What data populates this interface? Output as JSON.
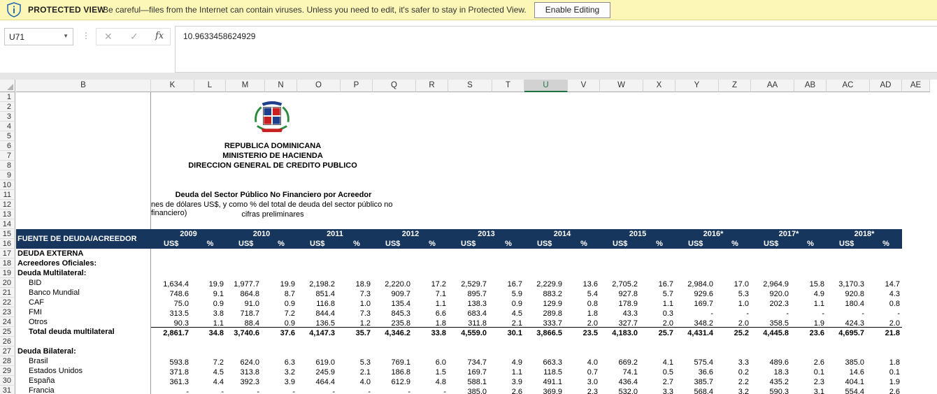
{
  "protected_view": {
    "label": "PROTECTED VIEW",
    "message": "Be careful—files from the Internet can contain viruses. Unless you need to edit, it's safer to stay in Protected View.",
    "button": "Enable Editing"
  },
  "formula_bar": {
    "name_box": "U71",
    "formula": "10.9633458624929",
    "fx_label": "fx"
  },
  "columns": [
    "B",
    "K",
    "L",
    "M",
    "N",
    "O",
    "P",
    "Q",
    "R",
    "S",
    "T",
    "U",
    "V",
    "W",
    "X",
    "Y",
    "Z",
    "AA",
    "AB",
    "AC",
    "AD",
    "AE"
  ],
  "selected_column": "U",
  "row_numbers": [
    "1",
    "2",
    "3",
    "4",
    "5",
    "6",
    "7",
    "8",
    "9",
    "10",
    "11",
    "12",
    "13",
    "14",
    "15",
    "16",
    "17",
    "18",
    "19",
    "20",
    "21",
    "22",
    "23",
    "24",
    "25",
    "26",
    "27",
    "28",
    "29",
    "30",
    "31"
  ],
  "header_lines": {
    "line1": "REPUBLICA DOMINICANA",
    "line2": "MINISTERIO DE HACIENDA",
    "line3": "DIRECCION GENERAL DE CREDITO PUBLICO"
  },
  "report_title": {
    "title": "Deuda del Sector Público No Financiero por Acreedor",
    "subtitle": "nes de dólares US$, y como % del total de deuda del sector público no financiero)",
    "note": "cifras preliminares"
  },
  "table_header": {
    "label": "FUENTE DE DEUDA/ACREEDOR",
    "years": [
      "2009",
      "2010",
      "2011",
      "2012",
      "2013",
      "2014",
      "2015",
      "2016*",
      "2017*",
      "2018*"
    ],
    "usd": "US$",
    "pct": "%"
  },
  "rows": [
    {
      "label": "DEUDA EXTERNA",
      "style": "bold",
      "values": []
    },
    {
      "label": "Acreedores Oficiales:",
      "style": "bold",
      "values": []
    },
    {
      "label": "Deuda Multilateral:",
      "style": "bold",
      "values": []
    },
    {
      "label": "BID",
      "style": "i1",
      "values": [
        "1,634.4",
        "19.9",
        "1,977.7",
        "19.9",
        "2,198.2",
        "18.9",
        "2,220.0",
        "17.2",
        "2,529.7",
        "16.7",
        "2,229.9",
        "13.6",
        "2,705.2",
        "16.7",
        "2,984.0",
        "17.0",
        "2,964.9",
        "15.8",
        "3,170.3",
        "14.7"
      ]
    },
    {
      "label": "Banco Mundial",
      "style": "i1",
      "values": [
        "748.6",
        "9.1",
        "864.8",
        "8.7",
        "851.4",
        "7.3",
        "909.7",
        "7.1",
        "895.7",
        "5.9",
        "883.2",
        "5.4",
        "927.8",
        "5.7",
        "929.6",
        "5.3",
        "920.0",
        "4.9",
        "920.8",
        "4.3"
      ]
    },
    {
      "label": "CAF",
      "style": "i1",
      "values": [
        "75.0",
        "0.9",
        "91.0",
        "0.9",
        "116.8",
        "1.0",
        "135.4",
        "1.1",
        "138.3",
        "0.9",
        "129.9",
        "0.8",
        "178.9",
        "1.1",
        "169.7",
        "1.0",
        "202.3",
        "1.1",
        "180.4",
        "0.8"
      ]
    },
    {
      "label": "FMI",
      "style": "i1",
      "values": [
        "313.5",
        "3.8",
        "718.7",
        "7.2",
        "844.4",
        "7.3",
        "845.3",
        "6.6",
        "683.4",
        "4.5",
        "289.8",
        "1.8",
        "43.3",
        "0.3",
        "-",
        "-",
        "-",
        "-",
        "-",
        "-"
      ]
    },
    {
      "label": "Otros",
      "style": "i1",
      "values": [
        "90.3",
        "1.1",
        "88.4",
        "0.9",
        "136.5",
        "1.2",
        "235.8",
        "1.8",
        "311.8",
        "2.1",
        "333.7",
        "2.0",
        "327.7",
        "2.0",
        "348.2",
        "2.0",
        "358.5",
        "1.9",
        "424.3",
        "2.0"
      ]
    },
    {
      "label": "Total deuda multilateral",
      "style": "total",
      "values": [
        "2,861.7",
        "34.8",
        "3,740.6",
        "37.6",
        "4,147.3",
        "35.7",
        "4,346.2",
        "33.8",
        "4,559.0",
        "30.1",
        "3,866.5",
        "23.5",
        "4,183.0",
        "25.7",
        "4,431.4",
        "25.2",
        "4,445.8",
        "23.6",
        "4,695.7",
        "21.8"
      ]
    },
    {
      "label": "",
      "style": "",
      "values": []
    },
    {
      "label": "Deuda Bilateral:",
      "style": "bold",
      "values": []
    },
    {
      "label": "Brasil",
      "style": "i1",
      "values": [
        "593.8",
        "7.2",
        "624.0",
        "6.3",
        "619.0",
        "5.3",
        "769.1",
        "6.0",
        "734.7",
        "4.9",
        "663.3",
        "4.0",
        "669.2",
        "4.1",
        "575.4",
        "3.3",
        "489.6",
        "2.6",
        "385.0",
        "1.8"
      ]
    },
    {
      "label": "Estados Unidos",
      "style": "i1",
      "values": [
        "371.8",
        "4.5",
        "313.8",
        "3.2",
        "245.9",
        "2.1",
        "186.8",
        "1.5",
        "169.7",
        "1.1",
        "118.5",
        "0.7",
        "74.1",
        "0.5",
        "36.6",
        "0.2",
        "18.3",
        "0.1",
        "14.6",
        "0.1"
      ]
    },
    {
      "label": "España",
      "style": "i1",
      "values": [
        "361.3",
        "4.4",
        "392.3",
        "3.9",
        "464.4",
        "4.0",
        "612.9",
        "4.8",
        "588.1",
        "3.9",
        "491.1",
        "3.0",
        "436.4",
        "2.7",
        "385.7",
        "2.2",
        "435.2",
        "2.3",
        "404.1",
        "1.9"
      ]
    },
    {
      "label": "Francia",
      "style": "i1",
      "values": [
        "-",
        "-",
        "-",
        "-",
        "-",
        "-",
        "-",
        "-",
        "385.0",
        "2.6",
        "369.9",
        "2.3",
        "532.0",
        "3.3",
        "568.4",
        "3.2",
        "590.3",
        "3.1",
        "554.4",
        "2.6"
      ]
    }
  ]
}
